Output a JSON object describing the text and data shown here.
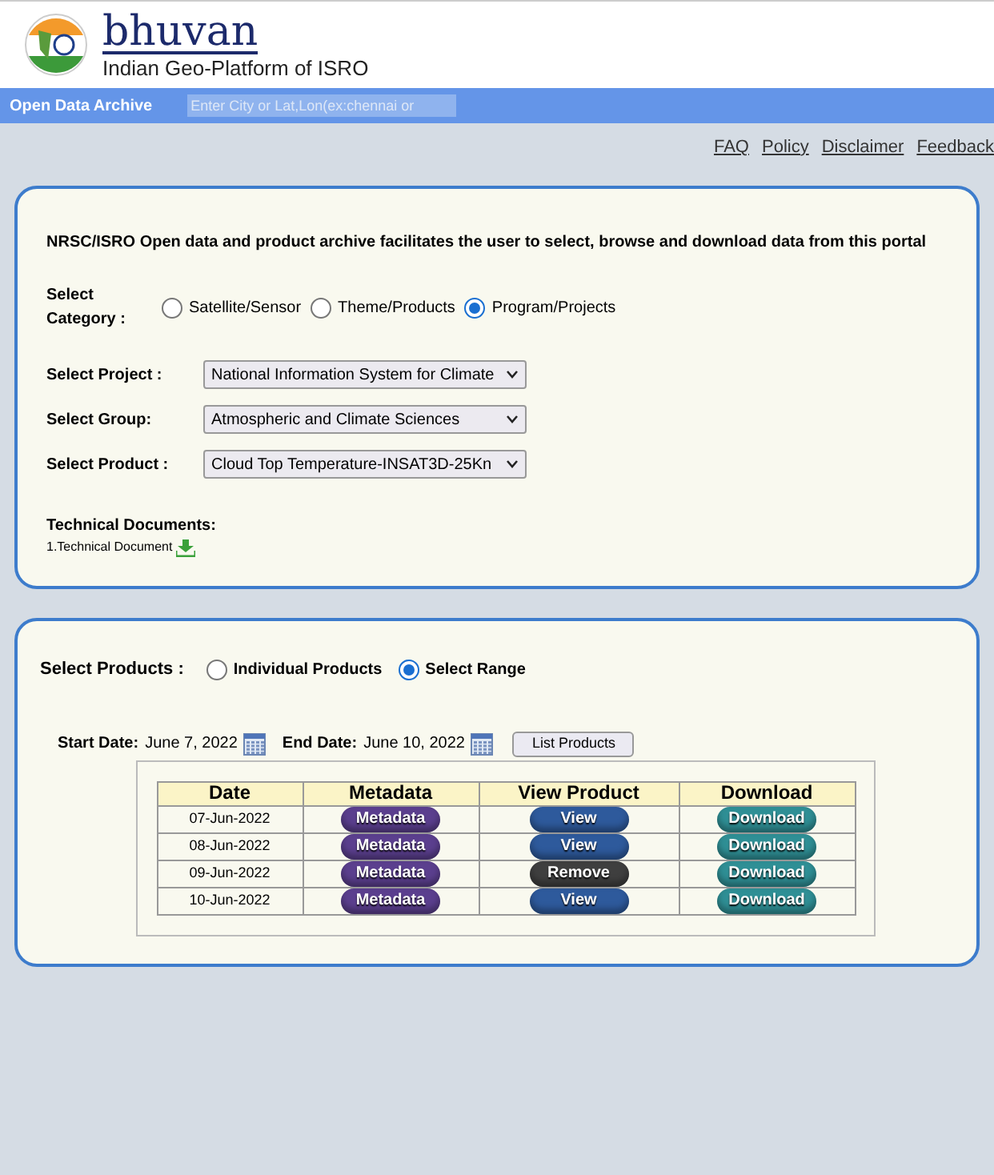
{
  "header": {
    "logo_text": "bhuvan",
    "tagline": "Indian Geo-Platform of ISRO"
  },
  "navbar": {
    "title": "Open Data Archive",
    "search": {
      "placeholder": "Enter City or Lat,Lon(ex:chennai or"
    }
  },
  "top_links": [
    "FAQ",
    "Policy",
    "Disclaimer",
    "Feedback"
  ],
  "intro": "NRSC/ISRO Open data and product archive facilitates the user to select, browse and download data from this portal",
  "category": {
    "label": "Select Category :",
    "options": [
      {
        "label": "Satellite/Sensor",
        "selected": false
      },
      {
        "label": "Theme/Products",
        "selected": false
      },
      {
        "label": "Program/Projects",
        "selected": true
      }
    ]
  },
  "selects": [
    {
      "label": "Select Project :",
      "value": "National Information System for Climate"
    },
    {
      "label": "Select Group:",
      "value": "Atmospheric and Climate Sciences"
    },
    {
      "label": "Select Product :",
      "value": "Cloud Top Temperature-INSAT3D-25Kn"
    }
  ],
  "technical_documents": {
    "title": "Technical Documents:",
    "items": [
      "1.Technical Document"
    ]
  },
  "products": {
    "label": "Select Products :",
    "options": [
      {
        "label": "Individual Products",
        "selected": false
      },
      {
        "label": "Select Range",
        "selected": true
      }
    ]
  },
  "range": {
    "start_label": "Start Date:",
    "start": "June 7, 2022",
    "end_label": "End Date:",
    "end": "June 10, 2022",
    "button": "List Products"
  },
  "table": {
    "columns": [
      "Date",
      "Metadata",
      "View Product",
      "Download"
    ],
    "rows": [
      {
        "date": "07-Jun-2022",
        "metadata": "Metadata",
        "view": {
          "kind": "view",
          "label": "View"
        },
        "download": "Download"
      },
      {
        "date": "08-Jun-2022",
        "metadata": "Metadata",
        "view": {
          "kind": "view",
          "label": "View"
        },
        "download": "Download"
      },
      {
        "date": "09-Jun-2022",
        "metadata": "Metadata",
        "view": {
          "kind": "remove",
          "label": "Remove"
        },
        "download": "Download"
      },
      {
        "date": "10-Jun-2022",
        "metadata": "Metadata",
        "view": {
          "kind": "view",
          "label": "View"
        },
        "download": "Download"
      }
    ]
  }
}
